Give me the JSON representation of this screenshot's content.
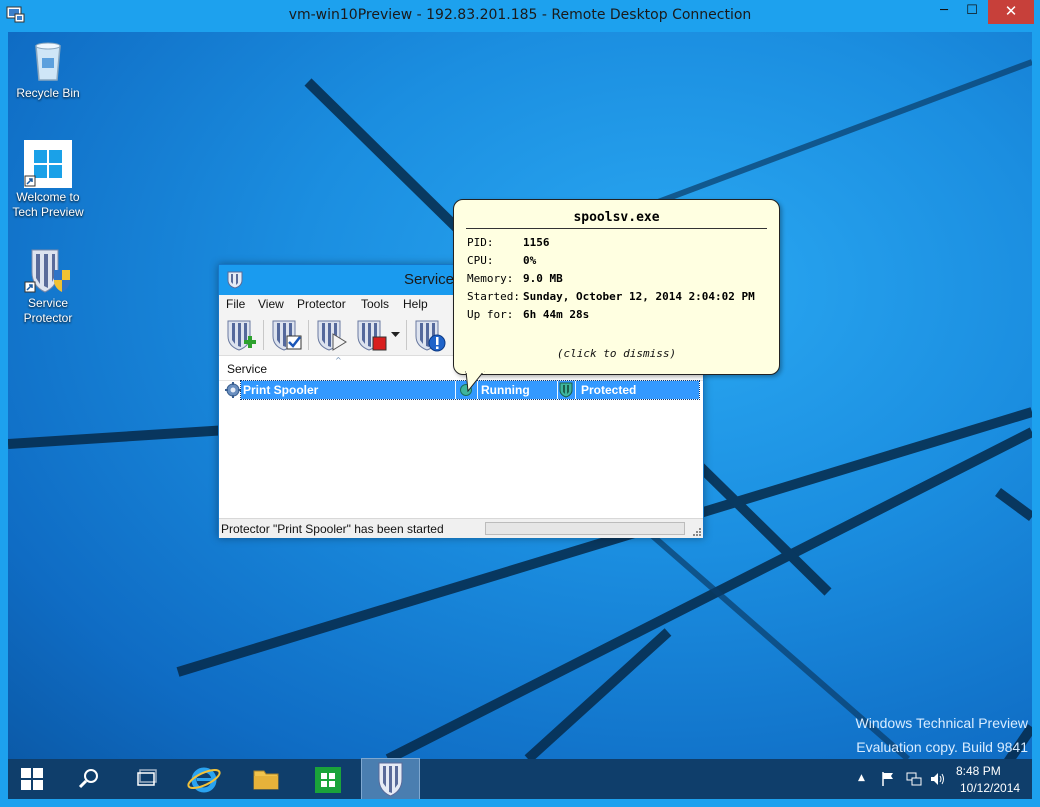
{
  "rdp": {
    "title": "vm-win10Preview - 192.83.201.185 - Remote Desktop Connection",
    "minimize": "─",
    "maximize": "☐",
    "close": "✕"
  },
  "desktop_icons": [
    {
      "label": "Recycle Bin"
    },
    {
      "label": "Welcome to Tech Preview"
    },
    {
      "label": "Service Protector"
    }
  ],
  "watermark": {
    "line1": "Windows Technical Preview",
    "line2": "Evaluation copy. Build 9841"
  },
  "app": {
    "title": "Service",
    "menu": [
      "File",
      "View",
      "Protector",
      "Tools",
      "Help"
    ],
    "toolbar": [
      "add-service",
      "check-service",
      "start-service",
      "stop-service",
      "dropdown",
      "about"
    ],
    "column_header": "Service",
    "row": {
      "service": "Print Spooler",
      "state": "Running",
      "protection": "Protected"
    },
    "status": "Protector \"Print Spooler\" has been started"
  },
  "balloon": {
    "title": "spoolsv.exe",
    "rows": [
      {
        "key": "PID:",
        "value": "1156"
      },
      {
        "key": "CPU:",
        "value": "0%"
      },
      {
        "key": "Memory:",
        "value": "9.0 MB"
      },
      {
        "key": "Started:",
        "value": "Sunday, October 12, 2014 2:04:02 PM"
      },
      {
        "key": "Up for:",
        "value": "6h 44m 28s"
      }
    ],
    "dismiss": "(click to dismiss)"
  },
  "taskbar": {
    "items": [
      "start",
      "search",
      "task-view",
      "internet-explorer",
      "file-explorer",
      "store",
      "service-protector"
    ],
    "tray_chevron": "▲",
    "clock_time": "8:48 PM",
    "clock_date": "10/12/2014"
  }
}
